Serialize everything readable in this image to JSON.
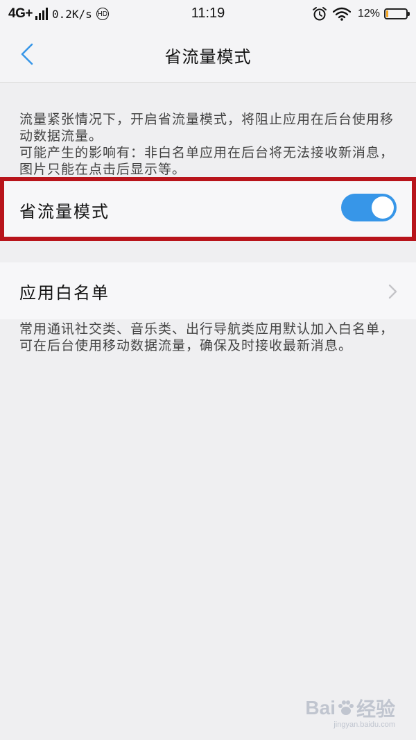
{
  "status_bar": {
    "network": "4G+",
    "speed": "0.2K/s",
    "hd_badge": "HD",
    "time": "11:19",
    "battery_text": "12%",
    "battery_level": 0.12,
    "icons": [
      "signal-icon",
      "hd-icon",
      "alarm-icon",
      "wifi-icon",
      "battery-icon"
    ],
    "battery_color": "#f5a623"
  },
  "nav": {
    "title": "省流量模式",
    "back_icon": "chevron-left-icon",
    "accent": "#3796e8"
  },
  "description_top": {
    "line1": "流量紧张情况下，开启省流量模式，将阻止应用在后台使用移动数据流量。",
    "line2": "可能产生的影响有：非白名单应用在后台将无法接收新消息，图片只能在点击后显示等。"
  },
  "toggle_row": {
    "label": "省流量模式",
    "enabled": true,
    "highlight_color": "#b8141b",
    "switch_color": "#3796e8"
  },
  "whitelist_row": {
    "label": "应用白名单",
    "icon": "chevron-right-icon"
  },
  "description_bottom": {
    "text": "常用通讯社交类、音乐类、出行导航类应用默认加入白名单，可在后台使用移动数据流量，确保及时接收最新消息。"
  },
  "watermark": {
    "logo_left": "Bai",
    "logo_right": "经验",
    "url": "jingyan.baidu.com"
  }
}
